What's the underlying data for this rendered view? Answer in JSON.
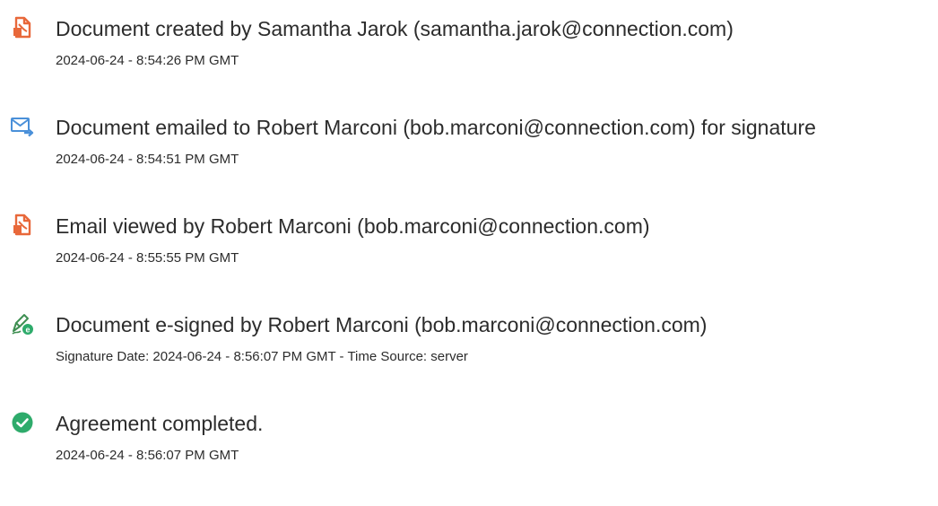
{
  "colors": {
    "doc_icon": "#e8683a",
    "email_icon": "#4a90d9",
    "sign_icon": "#2e8b57",
    "check_icon": "#2eab6b",
    "text": "#2c2c2c"
  },
  "events": [
    {
      "icon": "document-icon",
      "title": "Document created by Samantha Jarok (samantha.jarok@connection.com)",
      "meta": "2024-06-24 - 8:54:26 PM GMT"
    },
    {
      "icon": "email-sent-icon",
      "title": "Document emailed to Robert Marconi (bob.marconi@connection.com) for signature",
      "meta": "2024-06-24 - 8:54:51 PM GMT"
    },
    {
      "icon": "document-icon",
      "title": "Email viewed by Robert Marconi (bob.marconi@connection.com)",
      "meta": "2024-06-24 - 8:55:55 PM GMT"
    },
    {
      "icon": "e-sign-pen-icon",
      "title": "Document e-signed by Robert Marconi (bob.marconi@connection.com)",
      "meta": "Signature Date: 2024-06-24 - 8:56:07 PM GMT - Time Source: server"
    },
    {
      "icon": "check-circle-icon",
      "title": "Agreement completed.",
      "meta": "2024-06-24 - 8:56:07 PM GMT"
    }
  ]
}
